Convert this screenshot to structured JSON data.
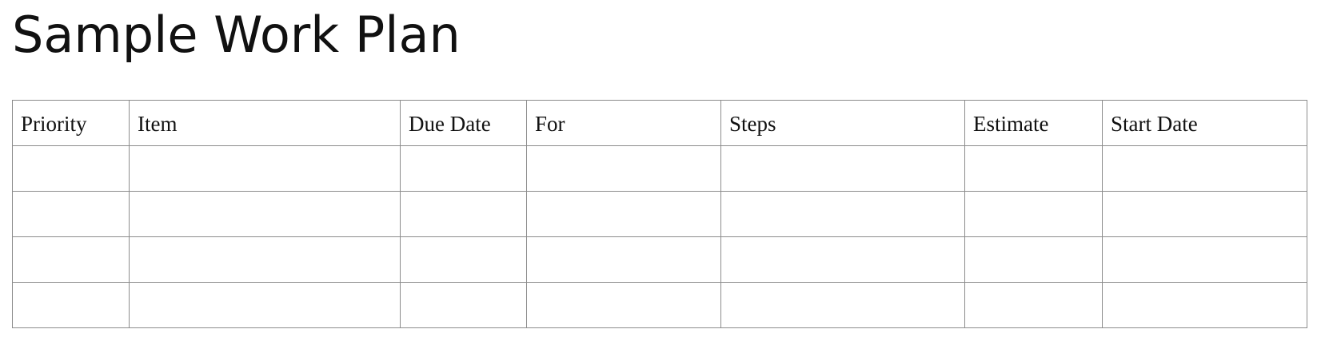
{
  "document": {
    "title": "Sample Work Plan"
  },
  "table": {
    "headers": [
      "Priority",
      "Item",
      "Due Date",
      "For",
      "Steps",
      "Estimate",
      "Start Date"
    ],
    "rows": [
      [
        "",
        "",
        "",
        "",
        "",
        "",
        ""
      ],
      [
        "",
        "",
        "",
        "",
        "",
        "",
        ""
      ],
      [
        "",
        "",
        "",
        "",
        "",
        "",
        ""
      ],
      [
        "",
        "",
        "",
        "",
        "",
        "",
        ""
      ]
    ]
  }
}
